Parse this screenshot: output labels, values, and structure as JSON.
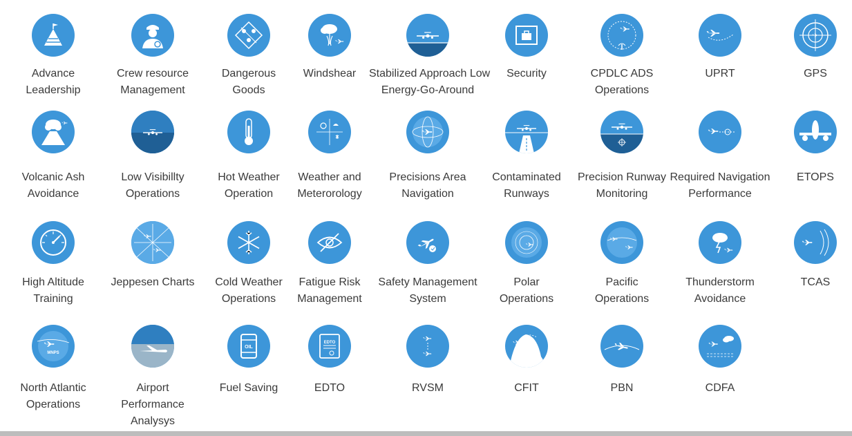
{
  "colors": {
    "accent": "#3d96d9",
    "accent_dark": "#1f5f95",
    "text": "#3a3a3a",
    "background": "#ffffff"
  },
  "courses": [
    {
      "label": "Advance\nLeadership",
      "icon": "mountain-flag-icon"
    },
    {
      "label": "Crew resource\nManagement",
      "icon": "pilot-icon"
    },
    {
      "label": "Dangerous\nGoods",
      "icon": "hazmat-icon"
    },
    {
      "label": "Windshear",
      "icon": "windshear-icon"
    },
    {
      "label": "Stabilized Approach Low\nEnergy-Go-Around",
      "icon": "approach-plane-icon"
    },
    {
      "label": "Security",
      "icon": "security-scanner-icon"
    },
    {
      "label": "CPDLC ADS\nOperations",
      "icon": "datalink-icon"
    },
    {
      "label": "UPRT",
      "icon": "upset-recovery-icon"
    },
    {
      "label": "GPS",
      "icon": "gps-target-icon"
    },
    {
      "label": "Volcanic Ash\nAvoidance",
      "icon": "volcano-icon"
    },
    {
      "label": "Low Visibillty\nOperations",
      "icon": "fog-plane-icon"
    },
    {
      "label": "Hot Weather\nOperation",
      "icon": "thermometer-icon"
    },
    {
      "label": "Weather and\nMeterorology",
      "icon": "weather-icon"
    },
    {
      "label": "Precisions Area\nNavigation",
      "icon": "globe-plane-icon"
    },
    {
      "label": "Contaminated\nRunways",
      "icon": "runway-icon"
    },
    {
      "label": "Precision Runway\nMonitoring",
      "icon": "runway-monitor-icon"
    },
    {
      "label": "Required Navigation\nPerformance",
      "icon": "rnp-icon"
    },
    {
      "label": "ETOPS",
      "icon": "twin-engine-icon"
    },
    {
      "label": "High Altitude\nTraining",
      "icon": "altimeter-icon"
    },
    {
      "label": "Jeppesen Charts",
      "icon": "chart-map-icon"
    },
    {
      "label": "Cold Weather\nOperations",
      "icon": "snowflake-icon"
    },
    {
      "label": "Fatigue Risk\nManagement",
      "icon": "closed-eye-icon"
    },
    {
      "label": "Safety Management\nSystem",
      "icon": "safety-plane-icon"
    },
    {
      "label": "Polar\nOperations",
      "icon": "polar-globe-icon"
    },
    {
      "label": "Pacific\nOperations",
      "icon": "pacific-globe-icon"
    },
    {
      "label": "Thunderstorm\nAvoidance",
      "icon": "thunderstorm-icon"
    },
    {
      "label": "TCAS",
      "icon": "tcas-icon"
    },
    {
      "label": "North Atlantic\nOperations",
      "icon": "nat-globe-icon",
      "badge": "MNPS"
    },
    {
      "label": "Airport\nPerformance\nAnalysys",
      "icon": "airport-plane-icon"
    },
    {
      "label": "Fuel Saving",
      "icon": "oil-barrel-icon",
      "badge": "OIL"
    },
    {
      "label": "EDTO",
      "icon": "edto-certificate-icon",
      "badge": "EDTO"
    },
    {
      "label": "RVSM",
      "icon": "rvsm-icon"
    },
    {
      "label": "CFIT",
      "icon": "terrain-icon"
    },
    {
      "label": "PBN",
      "icon": "pbn-icon"
    },
    {
      "label": "CDFA",
      "icon": "cdfa-icon"
    }
  ]
}
